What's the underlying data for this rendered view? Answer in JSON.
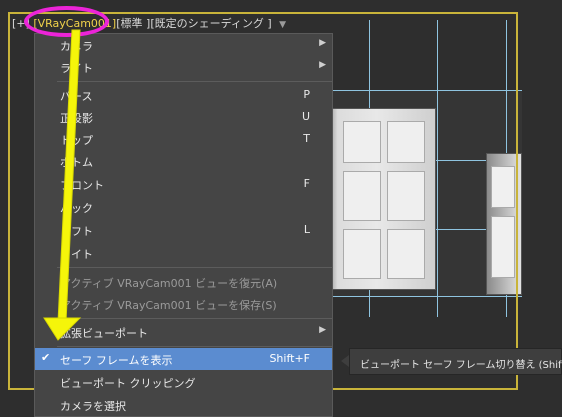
{
  "viewport": {
    "label_prefix": "[+]",
    "camera": "[VRayCam001]",
    "view_mode": "[標準 ]",
    "shading": "[既定のシェーディング ]",
    "filter_icon": "funnel-icon"
  },
  "menu": {
    "items": [
      {
        "label": "カメラ",
        "shortcut": "",
        "submenu": true,
        "disabled": false
      },
      {
        "label": "ライト",
        "shortcut": "",
        "submenu": true,
        "disabled": false
      },
      {
        "label": "パース",
        "shortcut": "P",
        "submenu": false,
        "disabled": false
      },
      {
        "label": "正投影",
        "shortcut": "U",
        "submenu": false,
        "disabled": false
      },
      {
        "label": "トップ",
        "shortcut": "T",
        "submenu": false,
        "disabled": false
      },
      {
        "label": "ボトム",
        "shortcut": "",
        "submenu": false,
        "disabled": false
      },
      {
        "label": "フロント",
        "shortcut": "F",
        "submenu": false,
        "disabled": false
      },
      {
        "label": "バック",
        "shortcut": "",
        "submenu": false,
        "disabled": false
      },
      {
        "label": "レフト",
        "shortcut": "L",
        "submenu": false,
        "disabled": false
      },
      {
        "label": "ライト",
        "shortcut": "",
        "submenu": false,
        "disabled": false
      },
      {
        "label": "アクティブ VRayCam001 ビューを復元(A)",
        "shortcut": "",
        "submenu": false,
        "disabled": true
      },
      {
        "label": "アクティブ VRayCam001 ビューを保存(S)",
        "shortcut": "",
        "submenu": false,
        "disabled": true
      },
      {
        "label": "拡張ビューポート",
        "shortcut": "",
        "submenu": true,
        "disabled": false
      },
      {
        "label": "セーフ フレームを表示",
        "shortcut": "Shift+F",
        "submenu": false,
        "disabled": false,
        "checked": true,
        "highlighted": true
      },
      {
        "label": "ビューポート クリッピング",
        "shortcut": "",
        "submenu": false,
        "disabled": false
      },
      {
        "label": "カメラを選択",
        "shortcut": "",
        "submenu": false,
        "disabled": false
      }
    ]
  },
  "tooltip": {
    "text": "ビューポート セーフ フレーム切り替え  (Shift+F)"
  },
  "colors": {
    "highlight": "#5b8cd0",
    "camera_label": "#f0d24a",
    "annotation_magenta": "#ec24d8",
    "annotation_arrow": "#f5f50a",
    "safe_frame": "#c9b43a"
  }
}
